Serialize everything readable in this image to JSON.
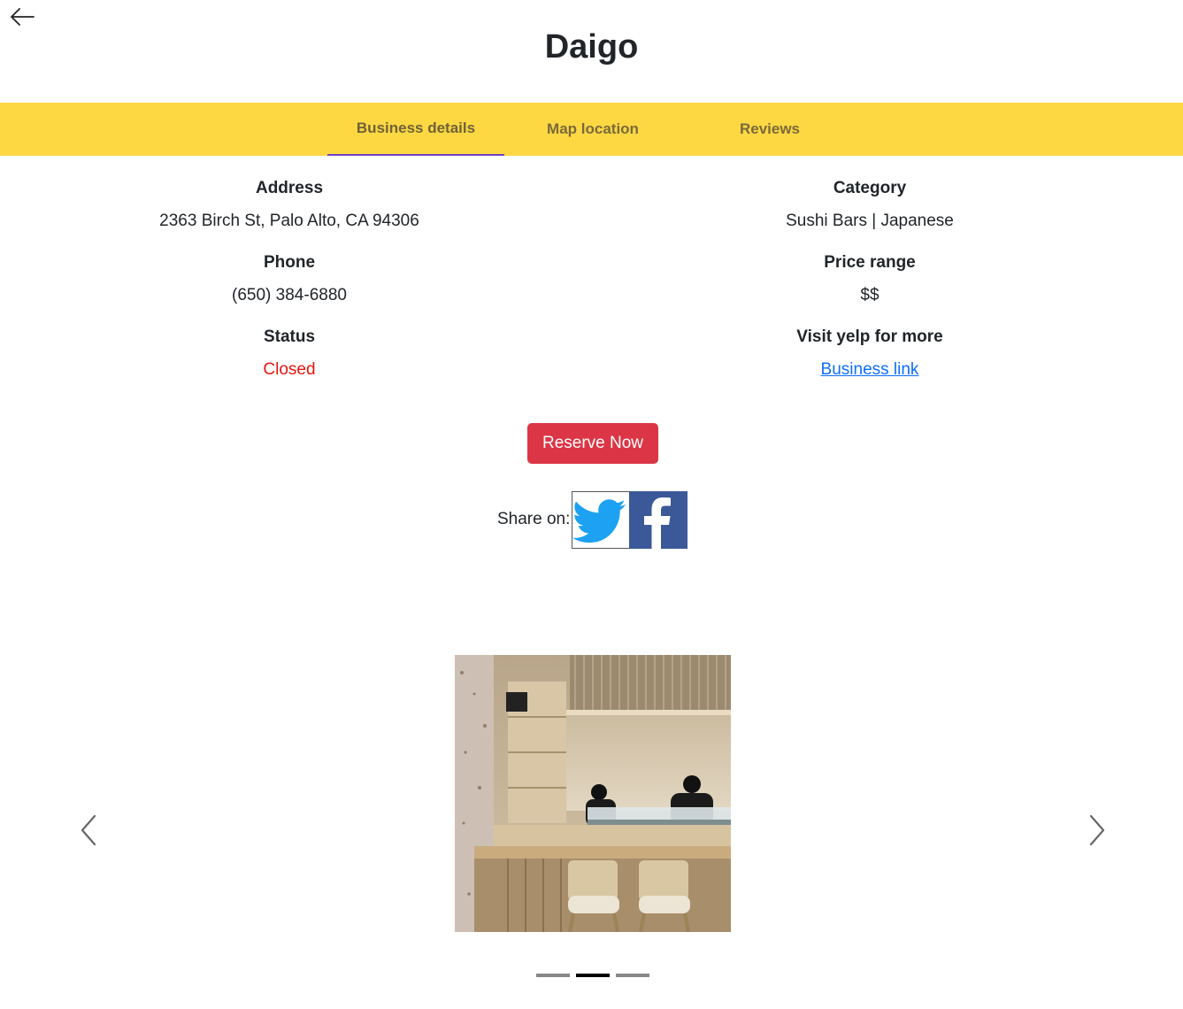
{
  "header": {
    "back_icon": "arrow-left-icon",
    "title": "Daigo"
  },
  "tabs": [
    {
      "label": "Business details",
      "active": true
    },
    {
      "label": "Map location",
      "active": false
    },
    {
      "label": "Reviews",
      "active": false
    }
  ],
  "colors": {
    "tabbar": "#fdd843",
    "tab_indicator": "#6f42c1",
    "status_closed": "#e8150f",
    "reserve_button": "#dc3545",
    "link": "#0d6efd",
    "twitter": "#1da1f2",
    "facebook": "#3b5998"
  },
  "details": {
    "address_label": "Address",
    "address_value": "2363 Birch St, Palo Alto, CA 94306",
    "phone_label": "Phone",
    "phone_value": "(650) 384-6880",
    "status_label": "Status",
    "status_value": "Closed",
    "category_label": "Category",
    "category_value": "Sushi Bars | Japanese",
    "price_label": "Price range",
    "price_value": "$$",
    "yelp_label": "Visit yelp for more",
    "yelp_link": "Business link"
  },
  "actions": {
    "reserve_label": "Reserve Now",
    "share_label": "Share on:",
    "share_icons": [
      "twitter-icon",
      "facebook-icon"
    ]
  },
  "carousel": {
    "prev_icon": "chevron-left-icon",
    "next_icon": "chevron-right-icon",
    "slide_count": 3,
    "active_index": 1
  }
}
